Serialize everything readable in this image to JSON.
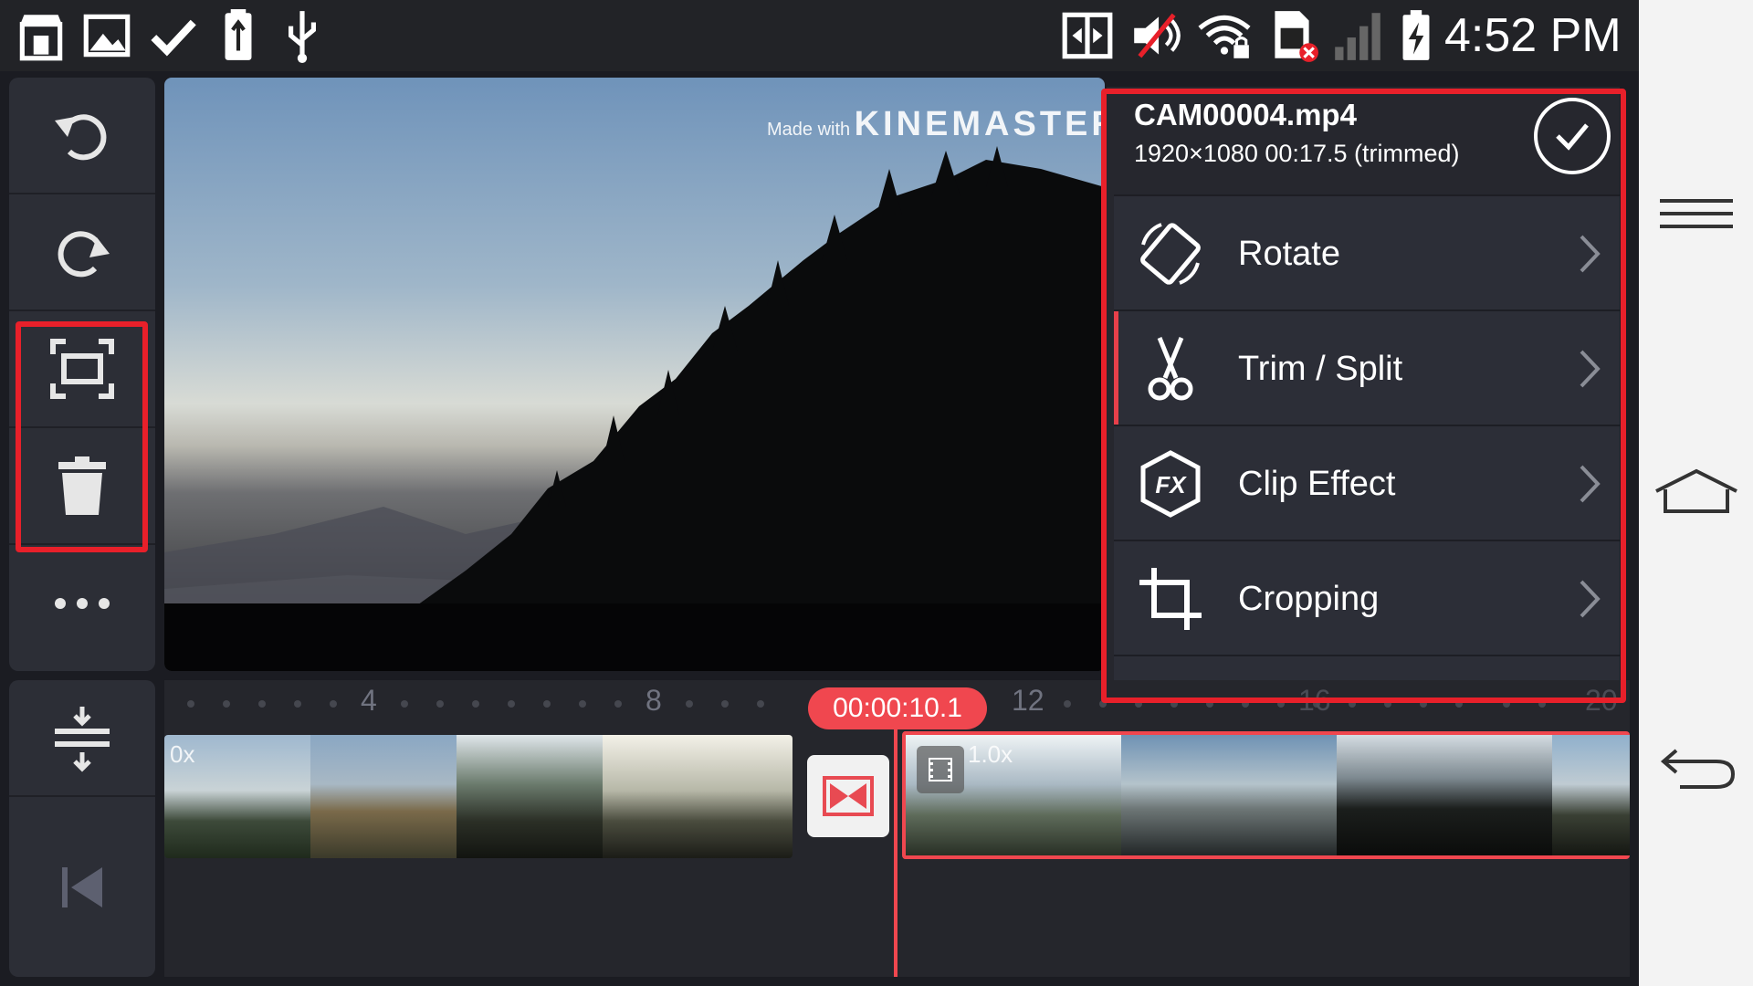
{
  "status_bar": {
    "time": "4:52 PM",
    "left_icons": [
      "store-icon",
      "gallery-icon",
      "check-icon",
      "usb-storage-icon",
      "usb-icon"
    ],
    "right_icons": [
      "screen-mirror-icon",
      "mute-icon",
      "wifi-lock-icon",
      "sim-error-icon",
      "signal-icon",
      "battery-charging-icon"
    ]
  },
  "left_toolbar": {
    "items": [
      "undo-icon",
      "redo-icon",
      "fullscreen-icon",
      "delete-icon",
      "more-icon"
    ],
    "bottom_items": [
      "timeline-expand-icon",
      "skip-to-start-icon"
    ]
  },
  "preview": {
    "watermark_small": "Made with",
    "watermark_big": "KINEMASTER"
  },
  "clip_panel": {
    "filename": "CAM00004.mp4",
    "info": "1920×1080  00:17.5 (trimmed)",
    "menu": [
      {
        "label": "Rotate",
        "icon": "rotate-icon"
      },
      {
        "label": "Trim / Split",
        "icon": "scissors-icon"
      },
      {
        "label": "Clip Effect",
        "icon": "fx-icon"
      },
      {
        "label": "Cropping",
        "icon": "crop-icon"
      }
    ]
  },
  "timeline": {
    "timecode": "00:00:10.1",
    "ruler_numbers": [
      "4",
      "8",
      "12",
      "16",
      "20"
    ],
    "clip1_speed": "0x",
    "clip2_speed": "1.0x"
  },
  "nav_bar": {
    "icons": [
      "menu-icon",
      "home-icon",
      "back-icon"
    ]
  },
  "colors": {
    "accent_red": "#e8202a",
    "timecode_pill": "#f0474f",
    "panel_bg": "#2c2e37"
  }
}
